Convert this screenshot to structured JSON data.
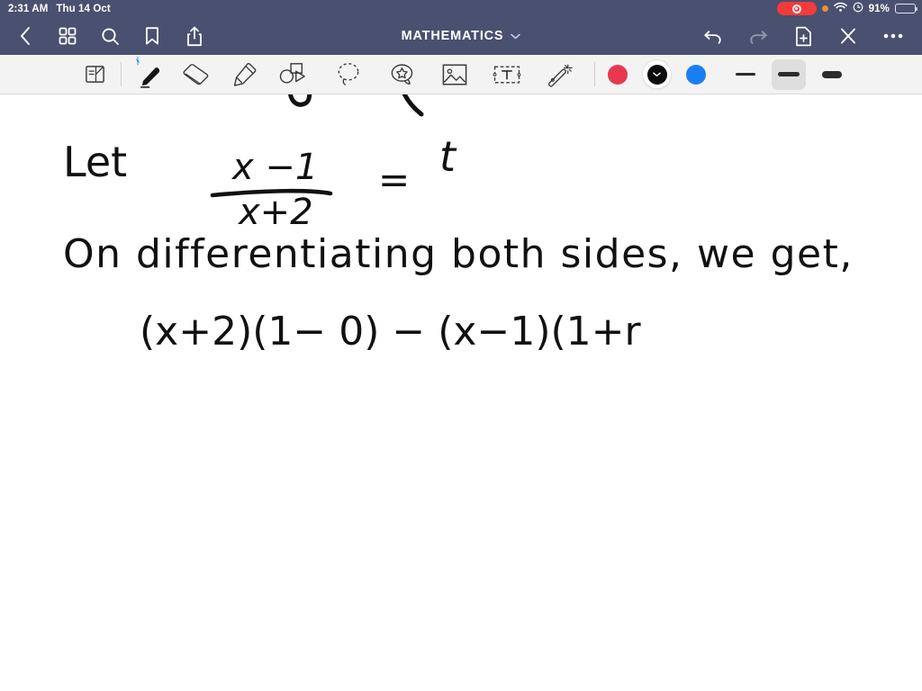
{
  "status_bar": {
    "time": "2:31 AM",
    "date": "Thu 14 Oct",
    "battery_percent": "91%",
    "icons": [
      "screen-recording-pill",
      "orange-privacy-dot",
      "wifi-icon",
      "rotation-lock-icon",
      "battery-icon"
    ]
  },
  "nav_bar": {
    "title": "MATHEMATICS",
    "left_icons": [
      "back-chevron-icon",
      "grid-thumbnails-icon",
      "search-icon",
      "bookmark-icon",
      "share-icon"
    ],
    "right_icons": [
      "undo-icon",
      "redo-icon",
      "add-page-icon",
      "close-icon",
      "more-icon"
    ],
    "accent_color": "#4a5070",
    "redo_disabled": true
  },
  "toolbar": {
    "page_flip_label": "page-flip",
    "tools": [
      {
        "name": "pen",
        "selected": true,
        "bluetooth_connected": true
      },
      {
        "name": "eraser",
        "selected": false
      },
      {
        "name": "highlighter",
        "selected": false
      },
      {
        "name": "shapes",
        "selected": false
      },
      {
        "name": "lasso-select",
        "selected": false
      },
      {
        "name": "sticker",
        "selected": false
      },
      {
        "name": "image",
        "selected": false
      },
      {
        "name": "text-box",
        "selected": false
      },
      {
        "name": "magic-wand",
        "selected": false
      }
    ],
    "colors": [
      {
        "name": "red",
        "hex": "#e8384f",
        "selected": false
      },
      {
        "name": "black",
        "hex": "#0d0d0d",
        "selected": true
      },
      {
        "name": "blue",
        "hex": "#1a7ef1",
        "selected": false
      }
    ],
    "stroke_widths": [
      {
        "name": "thin",
        "selected": false
      },
      {
        "name": "medium",
        "selected": true
      },
      {
        "name": "thick",
        "selected": false
      }
    ]
  },
  "canvas": {
    "background": "#ffffff",
    "ink_color": "#111111",
    "handwriting": {
      "clipped_top_strokes": [
        "u-curve-fragment",
        "diagonal-stroke-fragment"
      ],
      "line1": {
        "prefix": "Let",
        "fraction_numerator": "x −1",
        "fraction_denominator": "x+2",
        "equals": "=",
        "result": "t"
      },
      "line2": "On differentiating both sides, we get,",
      "line3": "(x+2)(1− 0) − (x−1)(1+r"
    }
  }
}
